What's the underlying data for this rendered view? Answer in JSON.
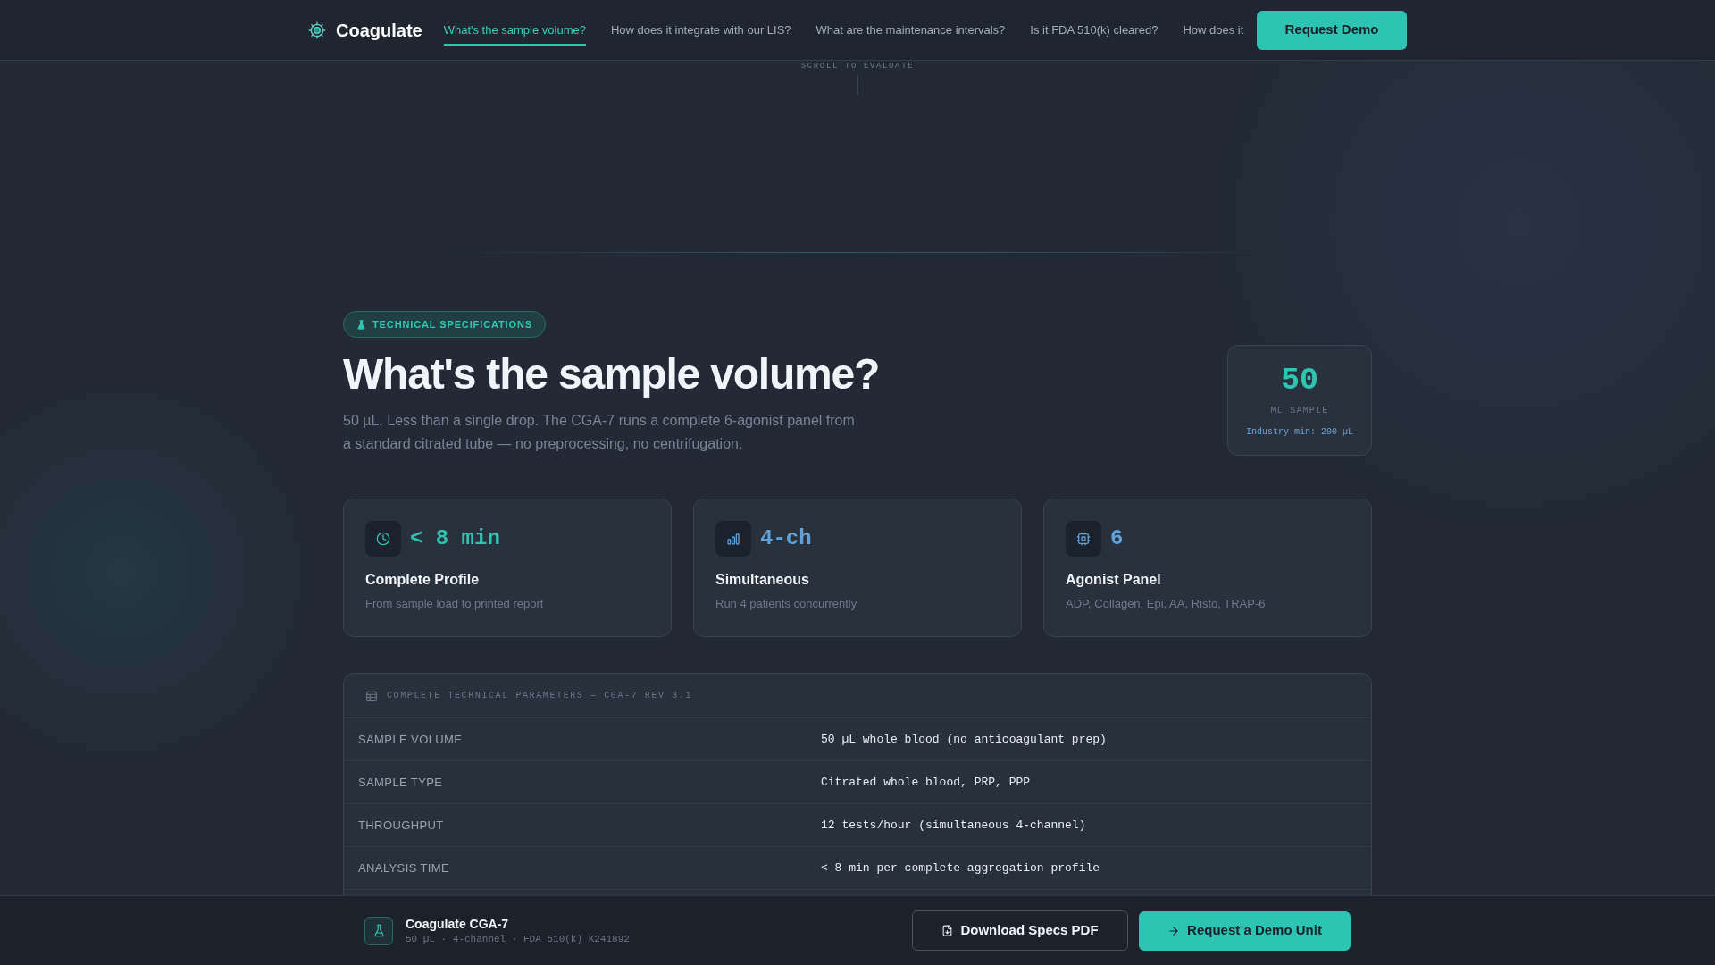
{
  "nav": {
    "brand": "Coagulate",
    "links": [
      {
        "label": "What's the sample volume?",
        "selected": true
      },
      {
        "label": "How does it integrate with our LIS?",
        "selected": false
      },
      {
        "label": "What are the maintenance intervals?",
        "selected": false
      },
      {
        "label": "Is it FDA 510(k) cleared?",
        "selected": false
      },
      {
        "label": "How does it",
        "selected": false
      }
    ],
    "cta": "Request Demo"
  },
  "scroll_hint": "SCROLL TO EVALUATE",
  "hero": {
    "badge": "TECHNICAL SPECIFICATIONS",
    "title": "What's the sample volume?",
    "description": "50 µL. Less than a single drop. The CGA-7 runs a complete 6-agonist panel from a standard citrated tube — no preprocessing, no centrifugation.",
    "stat": {
      "value": "50",
      "label": "ML SAMPLE",
      "note": "Industry min: 200 µL"
    }
  },
  "cards": [
    {
      "value": "< 8 min",
      "title": "Complete Profile",
      "description": "From sample load to printed report",
      "color": "#2ec4b0"
    },
    {
      "value": "4-ch",
      "title": "Simultaneous",
      "description": "Run 4 patients concurrently",
      "color": "#62a0d8"
    },
    {
      "value": "6",
      "title": "Agonist Panel",
      "description": "ADP, Collagen, Epi, AA, Risto, TRAP-6",
      "color": "#62a0d8"
    }
  ],
  "table": {
    "title": "COMPLETE TECHNICAL PARAMETERS — CGA-7 REV 3.1",
    "rows": [
      {
        "label": "SAMPLE VOLUME",
        "value": "50 µL whole blood (no anticoagulant prep)"
      },
      {
        "label": "SAMPLE TYPE",
        "value": "Citrated whole blood, PRP, PPP"
      },
      {
        "label": "THROUGHPUT",
        "value": "12 tests/hour (simultaneous 4-channel)"
      },
      {
        "label": "ANALYSIS TIME",
        "value": "< 8 min per complete aggregation profile"
      }
    ]
  },
  "footer": {
    "product": "Coagulate CGA-7",
    "details": "50 µL · 4-channel · FDA 510(k) K241892",
    "buttons": [
      {
        "label": "Download Specs PDF",
        "kind": "secondary"
      },
      {
        "label": "Request a Demo Unit",
        "kind": "primary"
      }
    ]
  }
}
